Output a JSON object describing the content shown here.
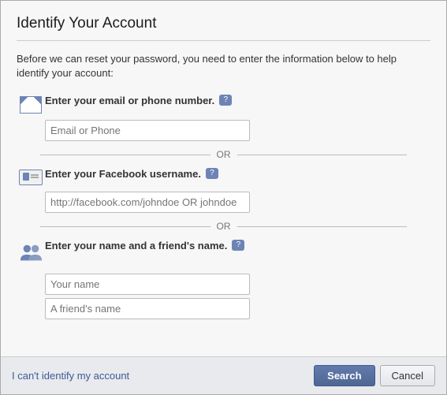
{
  "dialog": {
    "title": "Identify Your Account",
    "intro": "Before we can reset your password, you need to enter the information below to help identify your account:",
    "sections": [
      {
        "id": "email-section",
        "label": "Enter your email or phone number.",
        "help": "?",
        "icon": "mail-icon",
        "input": {
          "placeholder": "Email or Phone",
          "type": "text"
        }
      },
      {
        "id": "username-section",
        "label": "Enter your Facebook username.",
        "help": "?",
        "icon": "id-card-icon",
        "input": {
          "placeholder": "http://facebook.com/johndoe OR johndoe",
          "type": "text"
        }
      },
      {
        "id": "name-section",
        "label": "Enter your name and a friend's name.",
        "help": "?",
        "icon": "people-icon",
        "inputs": [
          {
            "placeholder": "Your name",
            "type": "text"
          },
          {
            "placeholder": "A friend's name",
            "type": "text"
          }
        ]
      }
    ],
    "or_label": "OR",
    "footer": {
      "cant_identify": "I can't identify my account",
      "search_button": "Search",
      "cancel_button": "Cancel"
    }
  }
}
